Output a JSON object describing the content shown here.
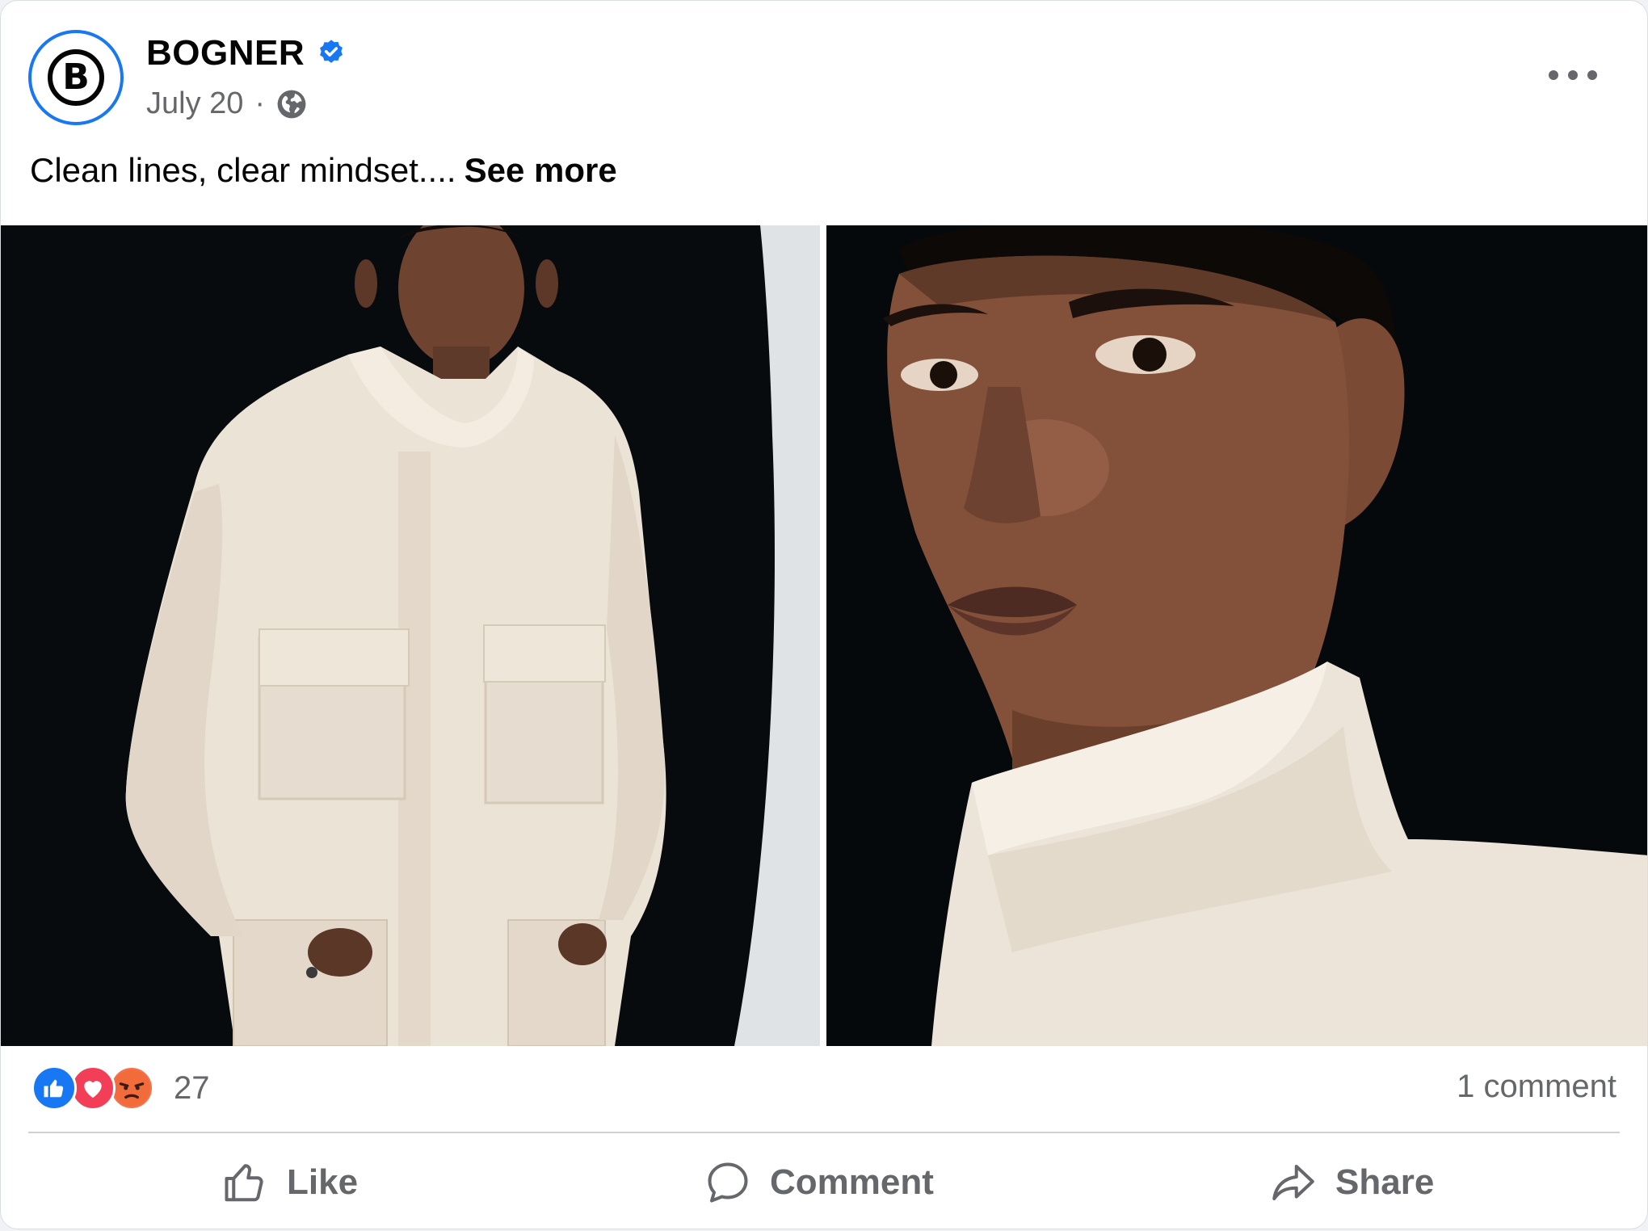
{
  "post": {
    "page_name": "BOGNER",
    "avatar_letter": "B",
    "date": "July 20",
    "separator": "·",
    "audience_icon": "globe-icon",
    "caption": "Clean lines, clear mindset....",
    "see_more": "See more"
  },
  "media": {
    "images": [
      {
        "description_icon": "photo",
        "subject": "model in cream jacket full view"
      },
      {
        "description_icon": "photo",
        "subject": "model close-up portrait"
      }
    ]
  },
  "engagement": {
    "reaction_icons": [
      "like-reaction-icon",
      "love-reaction-icon",
      "angry-reaction-icon"
    ],
    "reaction_count": "27",
    "comment_count": "1 comment"
  },
  "actions": {
    "like_label": "Like",
    "comment_label": "Comment",
    "share_label": "Share"
  },
  "colors": {
    "accent": "#1877f2",
    "secondary_text": "#65676b",
    "primary_text": "#050505",
    "love": "#f33e58",
    "angry": "#f7714c"
  }
}
